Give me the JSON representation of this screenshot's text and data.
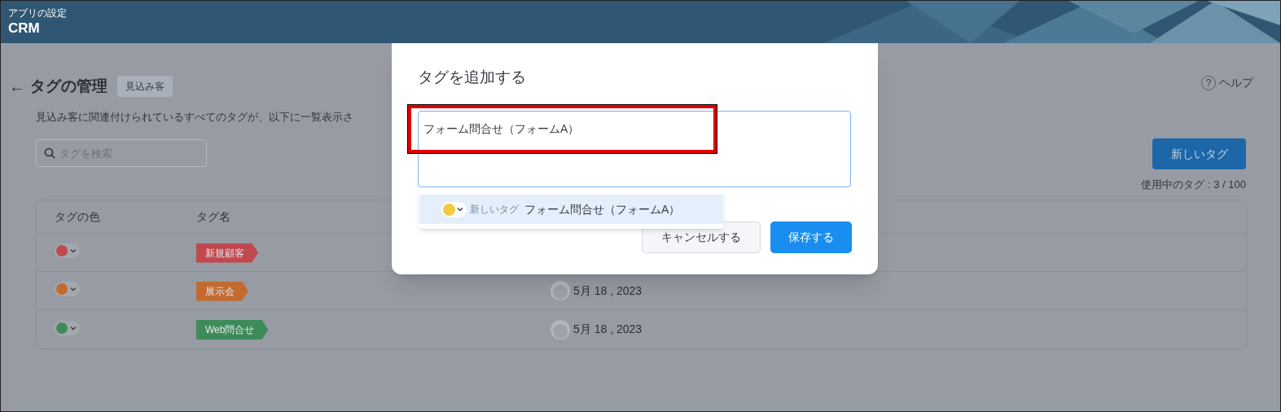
{
  "header": {
    "subtitle": "アプリの設定",
    "title": "CRM"
  },
  "page": {
    "back": "←",
    "title": "タグの管理",
    "badge": "見込み客",
    "description": "見込み客に関連付けられているすべてのタグが、以下に一覧表示さ",
    "search": {
      "placeholder": "タグを検索"
    },
    "help_icon": "?",
    "help": "ヘルプ",
    "new_button": "新しいタグ",
    "usage": "使用中のタグ : 3 / 100"
  },
  "table": {
    "columns": [
      "タグの色",
      "タグ名"
    ],
    "rows": [
      {
        "color": "#c0484f",
        "tag": "新規顧客"
      },
      {
        "color": "#c46a2e",
        "tag": "展示会",
        "date": "5月 18 , 2023"
      },
      {
        "color": "#3e8b5a",
        "tag": "Web問合せ",
        "date": "5月 18 , 2023"
      }
    ]
  },
  "modal": {
    "title": "タグを追加する",
    "input": {
      "value": "フォーム問合せ（フォームA）"
    },
    "suggestion": {
      "color": "#f5c842",
      "label": "新しいタグ",
      "text": "フォーム問合せ（フォームA）"
    },
    "buttons": [
      {
        "kind": "secondary",
        "label": "キャンセルする"
      },
      {
        "kind": "primary",
        "label": "保存する"
      }
    ]
  }
}
